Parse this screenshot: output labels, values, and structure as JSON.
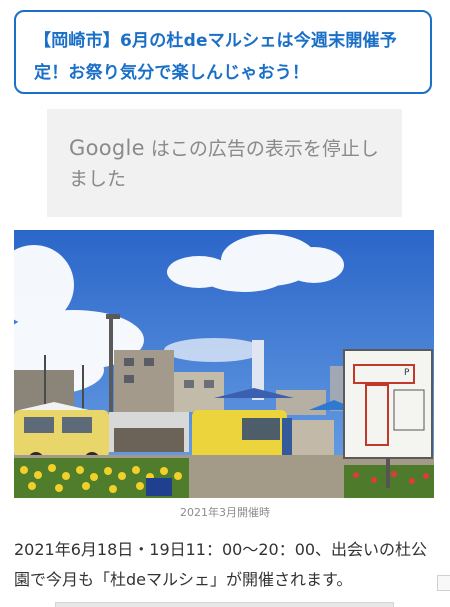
{
  "headline": {
    "text": "【岡崎市】6月の杜deマルシェは今週末開催予定！お祭り気分で楽しんじゃおう！"
  },
  "ad": {
    "brand": "Google",
    "message": "はこの広告の表示を停止しました"
  },
  "photo": {
    "caption": "2021年3月開催時",
    "sign_letter": "P"
  },
  "article": {
    "intro": "2021年6月18日・19日11：00〜20：00、出会いの杜公園で今月も「杜deマルシェ」が開催されます。"
  },
  "colors": {
    "link": "#1a6fc7",
    "ad_background": "#f1f1f1",
    "sky": "#2e6fd0"
  }
}
